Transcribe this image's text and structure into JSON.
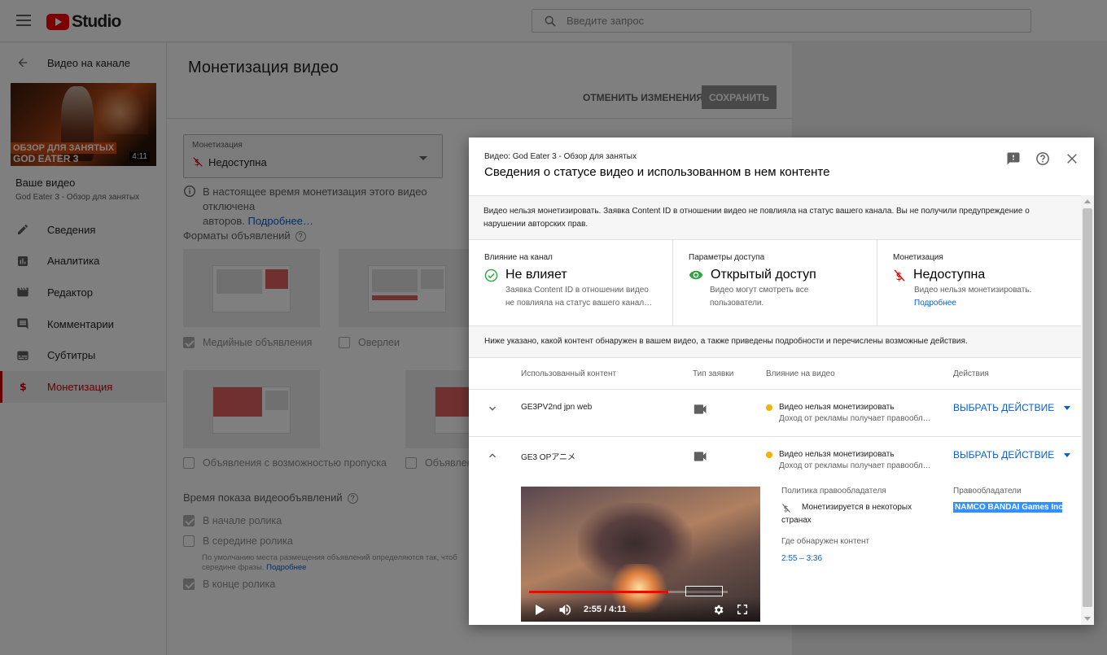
{
  "app": {
    "logo_text": "Studio"
  },
  "search": {
    "placeholder": "Введите запрос"
  },
  "sidebar": {
    "back_label": "Видео на канале",
    "thumb_caption_1": "ОБЗОР ДЛЯ ЗАНЯТЫХ",
    "thumb_caption_2": "GOD EATER 3",
    "thumb_duration": "4:11",
    "video_title": "Ваше видео",
    "video_subtitle": "God Eater 3 - Обзор для занятых",
    "items": [
      {
        "label": "Сведения",
        "icon": "pencil-icon"
      },
      {
        "label": "Аналитика",
        "icon": "analytics-icon"
      },
      {
        "label": "Редактор",
        "icon": "clapper-icon"
      },
      {
        "label": "Комментарии",
        "icon": "comment-icon"
      },
      {
        "label": "Субтитры",
        "icon": "subtitles-icon"
      },
      {
        "label": "Монетизация",
        "icon": "dollar-icon"
      }
    ]
  },
  "main": {
    "title": "Монетизация видео",
    "cancel_label": "Отменить изменения",
    "save_label": "СОХРАНИТЬ",
    "monetization_label": "Монетизация",
    "monetization_value": "Недоступна",
    "info_text": "В настоящее время монетизация этого видео отключена",
    "info_text_2": "авторов.",
    "info_link": "Подробнее…",
    "formats_label": "Форматы объявлений",
    "formats": [
      {
        "label": "Медийные объявления",
        "checked": true
      },
      {
        "label": "Оверлеи",
        "checked": false
      },
      {
        "label": "Объявления с возможностью пропуска",
        "checked": false
      },
      {
        "label": "Объявлен",
        "checked": false
      }
    ],
    "timing_label": "Время показа видеообъявлений",
    "timing": [
      {
        "label": "В начале ролика",
        "checked": true
      },
      {
        "label": "В середине ролика",
        "checked": false
      },
      {
        "label": "В конце ролика",
        "checked": true
      }
    ],
    "timing_note": "По умолчанию места размещения объявлений определяются так, чтоб",
    "timing_note_2": "середине фразы.",
    "timing_note_link": "Подробнее"
  },
  "dialog": {
    "subtitle": "Видео: God Eater 3 - Обзор для занятых",
    "title": "Сведения о статусе видео и использованном в нем контенте",
    "banner": "Видео нельзя монетизировать. Заявка Content ID в отношении видео не повлияла на статус вашего канала. Вы не получили предупреждение о нарушении авторских прав.",
    "status": [
      {
        "label": "Влияние на канал",
        "value": "Не влияет",
        "desc": "Заявка Content ID в отношении видео не повлияла на статус вашего канал…",
        "link": ""
      },
      {
        "label": "Параметры доступа",
        "value": "Открытый доступ",
        "desc": "Видео могут смотреть все пользователи.",
        "link": ""
      },
      {
        "label": "Монетизация",
        "value": "Недоступна",
        "desc": "Видео нельзя монетизировать.",
        "link": "Подробнее"
      }
    ],
    "content_banner": "Ниже указано, какой контент обнаружен в вашем видео, а также приведены подробности и перечислены возможные действия.",
    "table_headers": {
      "content": "Использованный контент",
      "claim_type": "Тип заявки",
      "impact": "Влияние на видео",
      "actions": "Действия"
    },
    "rows": [
      {
        "name": "GE3PV2nd jpn web",
        "impact": "Видео нельзя монетизировать",
        "impact_desc": "Доход от рекламы получает правообладатель",
        "action": "ВЫБРАТЬ ДЕЙСТВИЕ"
      },
      {
        "name": "GE3 OPアニメ",
        "impact": "Видео нельзя монетизировать",
        "impact_desc": "Доход от рекламы получает правообладатель",
        "action": "ВЫБРАТЬ ДЕЙСТВИЕ"
      }
    ],
    "detail": {
      "player_time": "2:55 / 4:11",
      "progress": 0.7,
      "policy_label": "Политика правообладателя",
      "policy_value": "Монетизируется в некоторых странах",
      "found_label": "Где обнаружен контент",
      "found_value": "2:55 – 3:36",
      "owners_label": "Правообладатели",
      "owner": "NAMCO BANDAI Games Inc."
    }
  }
}
